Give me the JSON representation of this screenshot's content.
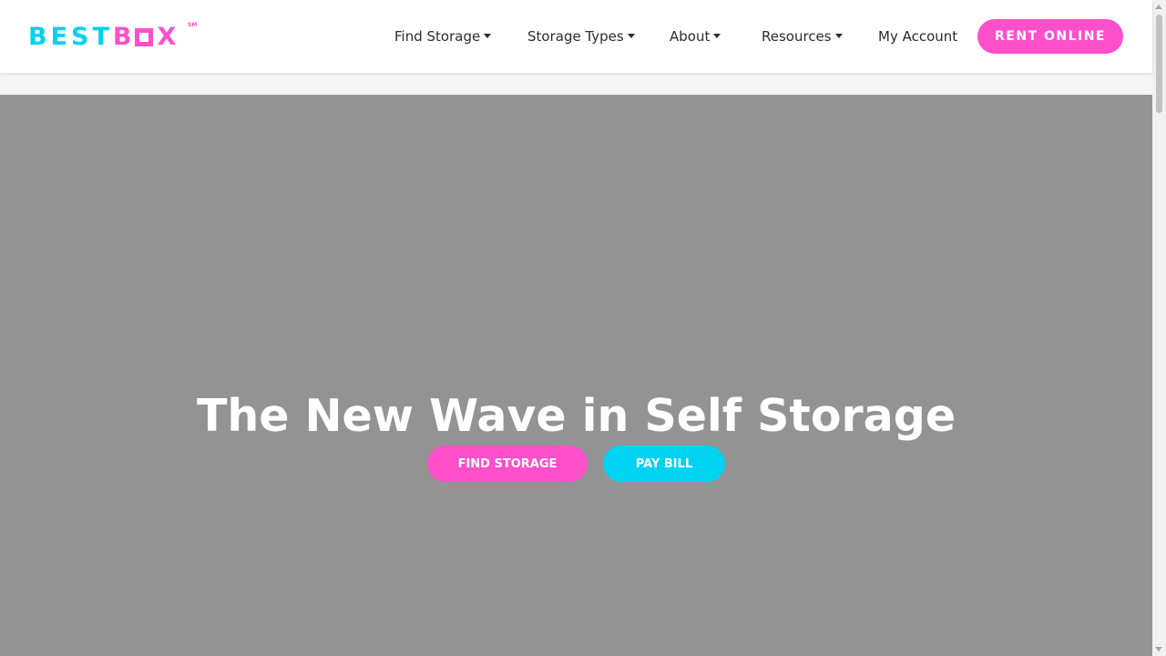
{
  "brand": {
    "logo_part1": "BEST",
    "logo_part2_b": "B",
    "logo_part2_x": "X",
    "logo_mark": "SM",
    "colors": {
      "cyan": "#00d2f0",
      "pink": "#ff4fcb",
      "hero_bg": "#939393"
    }
  },
  "nav": {
    "items": [
      {
        "label": "Find Storage",
        "dropdown": true
      },
      {
        "label": "Storage Types",
        "dropdown": true
      },
      {
        "label": "About",
        "dropdown": true
      },
      {
        "label": "Resources",
        "dropdown": true
      },
      {
        "label": "My Account",
        "dropdown": false
      }
    ],
    "cta_label": "RENT ONLINE"
  },
  "hero": {
    "title": "The New Wave in Self Storage",
    "find_storage_label": "FIND STORAGE",
    "pay_bill_label": "PAY BILL"
  },
  "icons": [
    "chevron-down-icon",
    "scroll-up-arrow-icon",
    "scroll-down-arrow-icon"
  ]
}
